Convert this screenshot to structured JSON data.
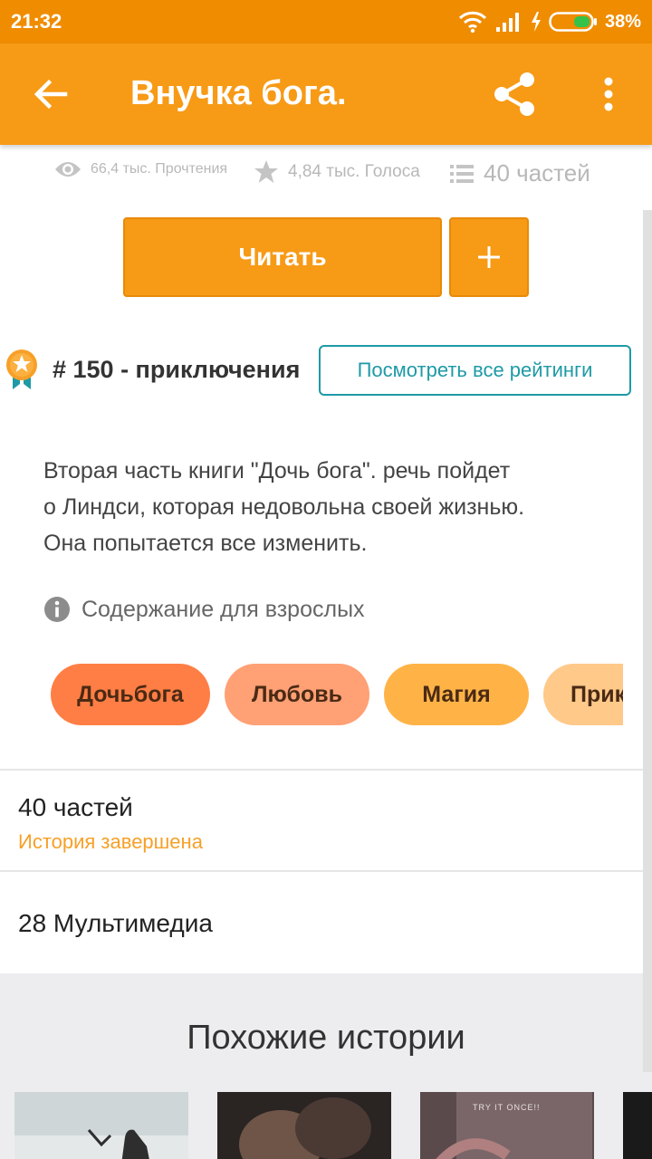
{
  "status_bar": {
    "time": "21:32",
    "battery": "38%"
  },
  "app_bar": {
    "title": "Внучка бога.",
    "icons": [
      "back-arrow-icon",
      "share-icon",
      "more-vert-icon"
    ]
  },
  "stats": {
    "reads": "66,4 тыс. Прочтения",
    "votes": "4,84 тыс. Голоса",
    "parts": "40 частей"
  },
  "actions": {
    "read_label": "Читать",
    "add_label": "+"
  },
  "ranking": {
    "rank": "# 150 - приключения",
    "view_all_label": "Посмотреть все рейтинги"
  },
  "description": {
    "lines": [
      "Вторая часть книги \"Дочь бога\". речь пойдет",
      "о Линдси, которая недовольна своей жизнью.",
      "Она попытается все изменить."
    ]
  },
  "mature": {
    "label": "Содержание для взрослых"
  },
  "tags": [
    {
      "label": "Дочьбога",
      "color": "#ff7e45"
    },
    {
      "label": "Любовь",
      "color": "#ffa075"
    },
    {
      "label": "Магия",
      "color": "#ffb347"
    },
    {
      "label": "Приключения",
      "color": "#ffc98a"
    }
  ],
  "parts_section": {
    "title": "40 частей",
    "status": "История завершена"
  },
  "media_section": {
    "title": "28 Мультимедиа"
  },
  "similar": {
    "title": "Похожие истории",
    "thumb_caption": "TRY IT ONCE!!"
  },
  "colors": {
    "status_bar": "#f08c00",
    "app_bar": "#f79a16",
    "accent_teal": "#1e9aa6",
    "complete_orange": "#f7a028"
  }
}
